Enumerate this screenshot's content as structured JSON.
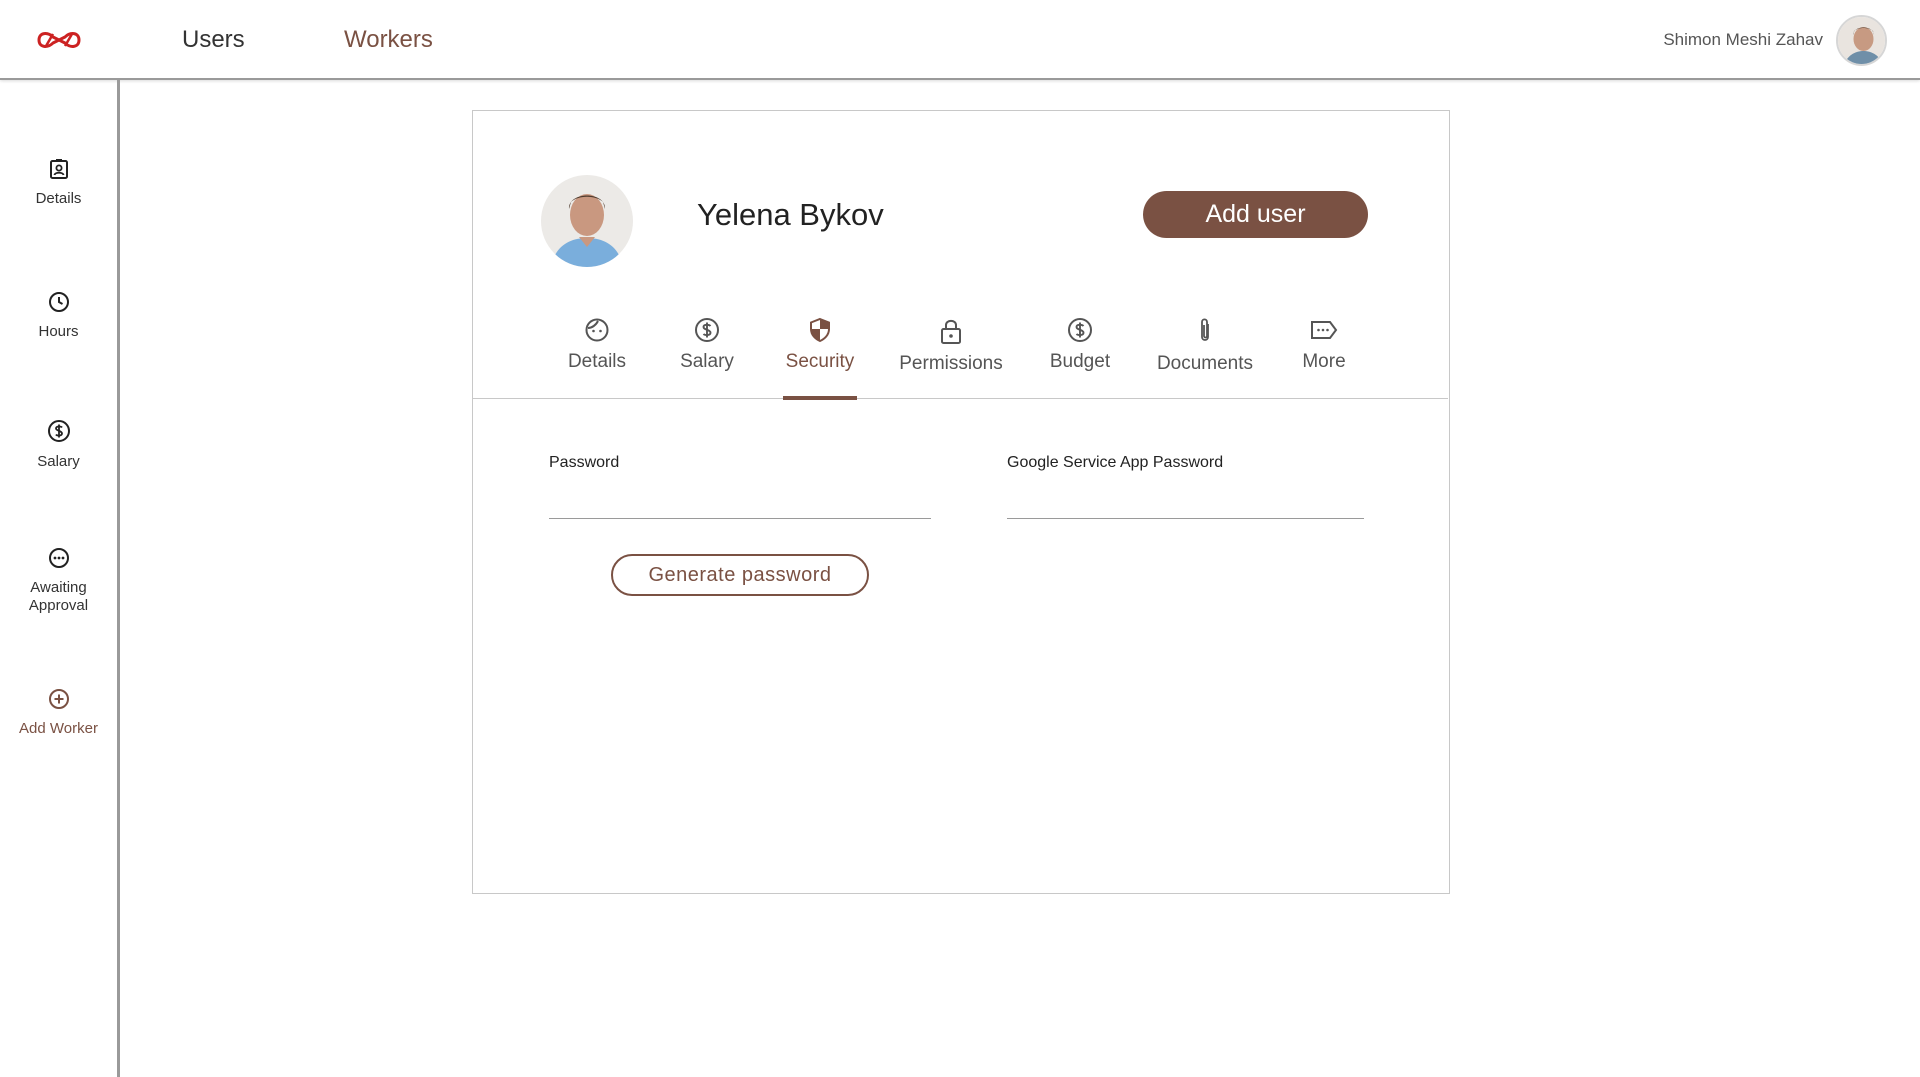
{
  "header": {
    "logo_icon": "infinity-logo-icon",
    "nav": [
      {
        "label": "Users",
        "active": false
      },
      {
        "label": "Workers",
        "active": true
      }
    ],
    "user_name": "Shimon Meshi Zahav",
    "avatar_icon": "user-avatar"
  },
  "sidebar": {
    "items": [
      {
        "label": "Details",
        "icon": "id-badge-icon"
      },
      {
        "label": "Hours",
        "icon": "clock-icon"
      },
      {
        "label": "Salary",
        "icon": "dollar-circle-icon"
      },
      {
        "label": "Awaiting Approval",
        "icon": "more-circle-icon"
      },
      {
        "label": "Add Worker",
        "icon": "plus-circle-icon"
      }
    ]
  },
  "profile": {
    "name": "Yelena Bykov",
    "add_user_label": "Add user"
  },
  "tabs": [
    {
      "label": "Details",
      "icon": "face-icon",
      "active": false
    },
    {
      "label": "Salary",
      "icon": "dollar-circle-icon",
      "active": false
    },
    {
      "label": "Security",
      "icon": "shield-icon",
      "active": true
    },
    {
      "label": "Permissions",
      "icon": "lock-icon",
      "active": false
    },
    {
      "label": "Budget",
      "icon": "dollar-circle-icon",
      "active": false
    },
    {
      "label": "Documents",
      "icon": "paperclip-icon",
      "active": false
    },
    {
      "label": "More",
      "icon": "tag-more-icon",
      "active": false
    }
  ],
  "security": {
    "password_label": "Password",
    "password_value": "",
    "google_password_label": "Google Service App Password",
    "google_password_value": "",
    "generate_label": "Generate password"
  },
  "colors": {
    "accent": "#7a5143",
    "logo": "#cc2222",
    "border": "#9a9a9a"
  }
}
